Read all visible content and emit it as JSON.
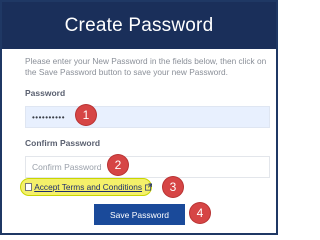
{
  "header": {
    "title": "Create Password"
  },
  "intro": "Please enter your New Password in the fields below, then click on the Save Password button to save your new Password.",
  "password": {
    "label": "Password",
    "value": "••••••••••"
  },
  "confirm": {
    "label": "Confirm Password",
    "placeholder": "Confirm Password"
  },
  "terms": {
    "label": "Accept Terms and Conditions"
  },
  "save_label": "Save Password",
  "steps": [
    "1",
    "2",
    "3",
    "4"
  ],
  "colors": {
    "header": "#1a2f5a",
    "button": "#1a4a9a",
    "badge": "#d64545",
    "highlight": "#f4f06a"
  }
}
